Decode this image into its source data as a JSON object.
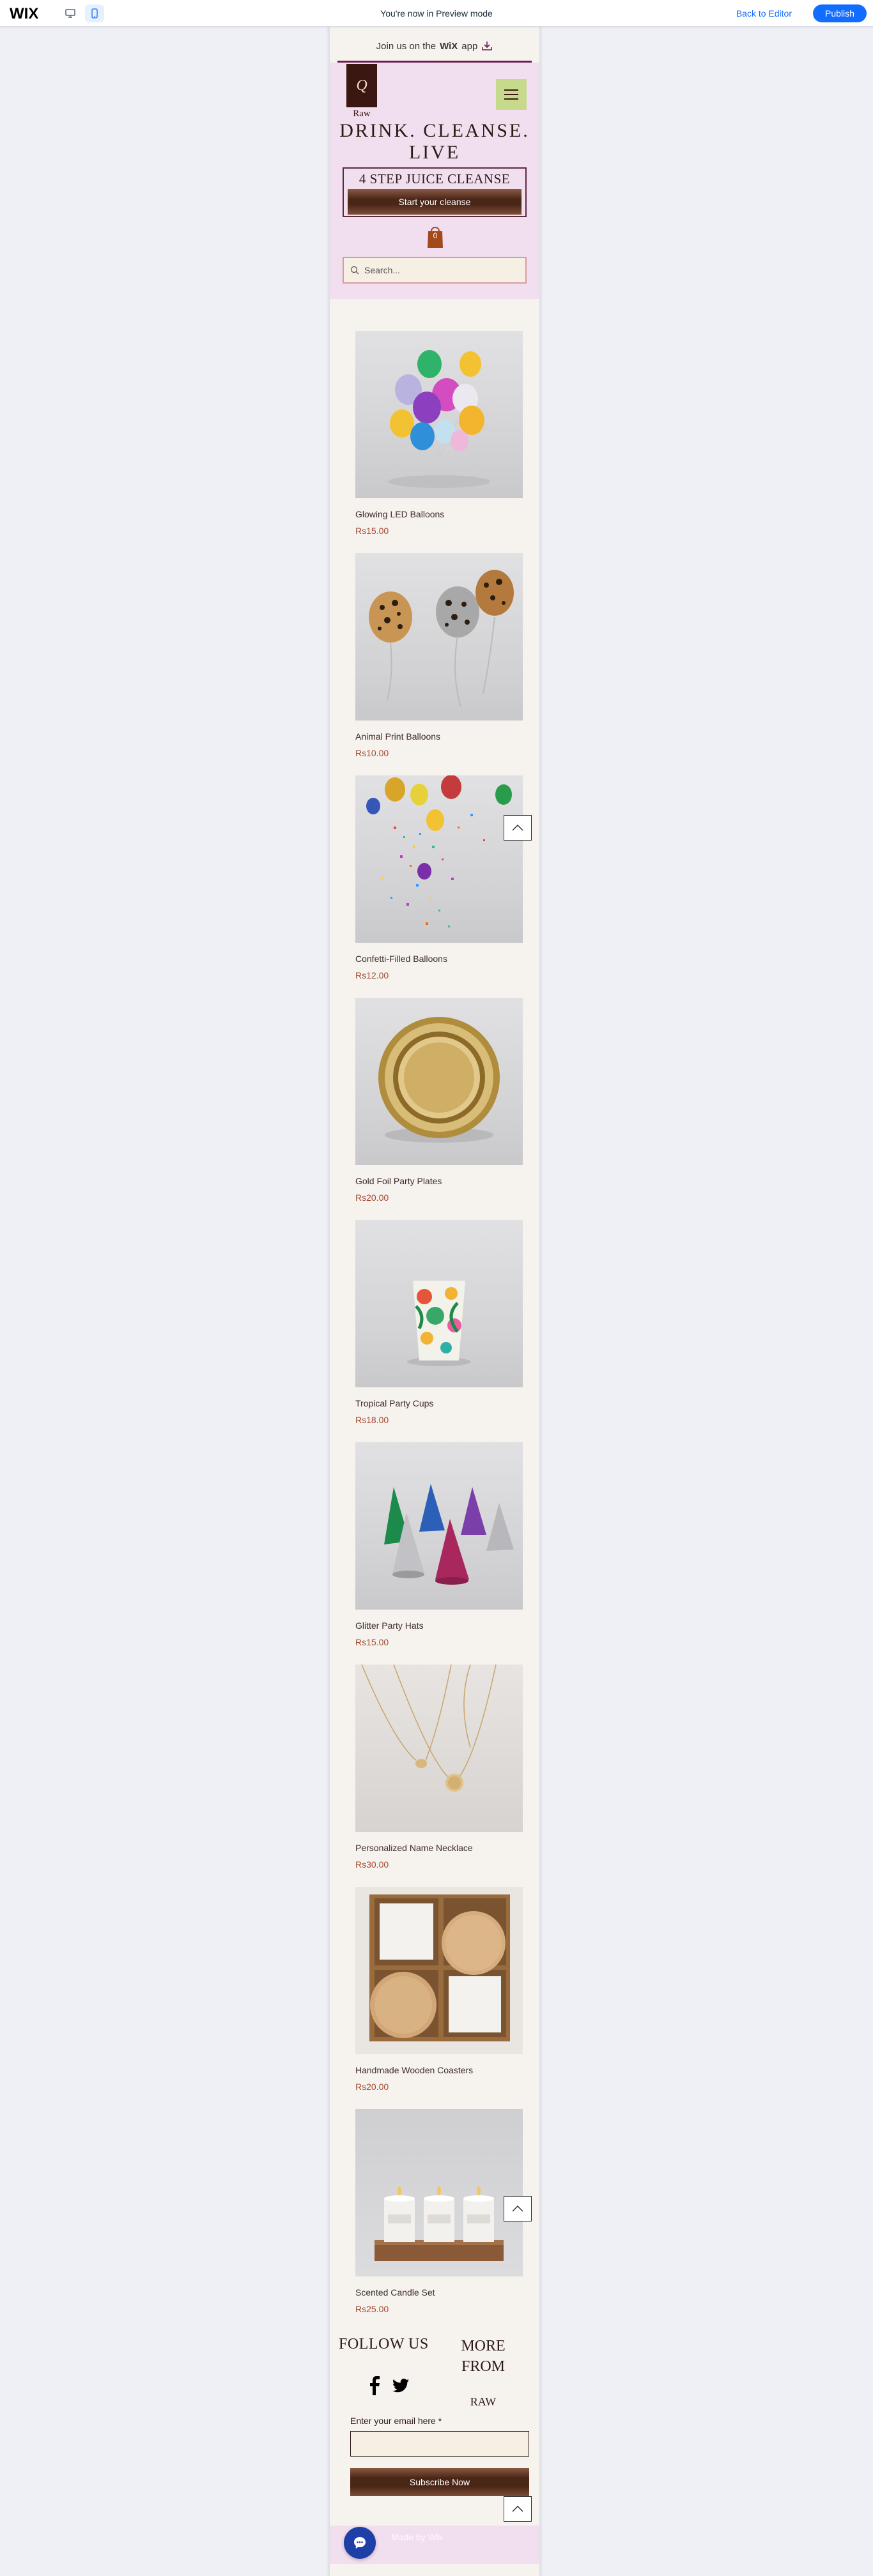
{
  "editor": {
    "logo": "WIX",
    "preview_text": "You're now in Preview mode",
    "back_to_editor": "Back to Editor",
    "publish": "Publish"
  },
  "app_banner": {
    "text_before": "Join us on the",
    "brand": "WiX",
    "text_after": "app"
  },
  "header": {
    "logo_letter": "Q",
    "logo_text": "Raw",
    "headline_line1": "DRINK. CLEANSE.",
    "headline_line2": "LIVE",
    "promo_title": "4 STEP JUICE CLEANSE",
    "promo_button": "Start your cleanse",
    "cart_count": "0",
    "search_placeholder": "Search..."
  },
  "products": [
    {
      "name": "Glowing LED Balloons",
      "price": "Rs15.00"
    },
    {
      "name": "Animal Print Balloons",
      "price": "Rs10.00"
    },
    {
      "name": "Confetti-Filled Balloons",
      "price": "Rs12.00"
    },
    {
      "name": "Gold Foil Party Plates",
      "price": "Rs20.00"
    },
    {
      "name": "Tropical Party Cups",
      "price": "Rs18.00"
    },
    {
      "name": "Glitter Party Hats",
      "price": "Rs15.00"
    },
    {
      "name": "Personalized Name Necklace",
      "price": "Rs30.00"
    },
    {
      "name": "Handmade Wooden Coasters",
      "price": "Rs20.00"
    },
    {
      "name": "Scented Candle Set",
      "price": "Rs25.00"
    }
  ],
  "footer": {
    "follow_us": "FOLLOW US",
    "more_from_line1": "MORE",
    "more_from_line2": "FROM",
    "more_from_brand": "RAW",
    "email_label": "Enter your email here *",
    "subscribe": "Subscribe Now",
    "bottom_band": "Made by Wix"
  },
  "colors": {
    "accent": "#116dff",
    "header_bg": "#f1dff0",
    "button_dark": "#4a2617",
    "price": "#a34a33"
  }
}
